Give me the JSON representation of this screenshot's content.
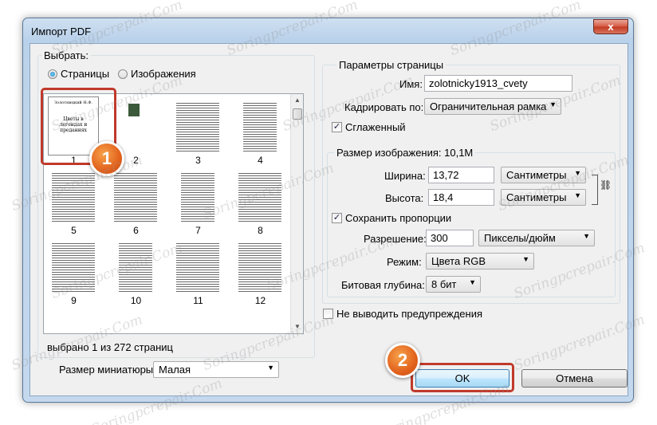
{
  "window": {
    "title": "Импорт PDF",
    "close_label": "x"
  },
  "select_group": {
    "label": "Выбрать:",
    "radio_pages": "Страницы",
    "radio_images": "Изображения",
    "selected": "Страницы"
  },
  "thumbnails": [
    {
      "num": "1",
      "selected": true,
      "cover_text": "Цветы в легендах и преданиях",
      "header": "Золотницкий Н.Ф."
    },
    {
      "num": "2"
    },
    {
      "num": "3"
    },
    {
      "num": "4"
    },
    {
      "num": "5"
    },
    {
      "num": "6"
    },
    {
      "num": "7"
    },
    {
      "num": "8"
    },
    {
      "num": "9"
    },
    {
      "num": "10"
    },
    {
      "num": "11"
    },
    {
      "num": "12"
    }
  ],
  "selection_status": "выбрано 1 из 272 страниц",
  "thumb_size": {
    "label": "Размер миниатюры:",
    "value": "Малая"
  },
  "page_params": {
    "label": "Параметры страницы",
    "name_label": "Имя:",
    "name_value": "zolotnicky1913_cvety",
    "crop_label": "Кадрировать по:",
    "crop_value": "Ограничительная рамка",
    "smoothed_label": "Сглаженный",
    "smoothed_checked": true
  },
  "image_size": {
    "label": "Размер изображения: 10,1M",
    "width_label": "Ширина:",
    "width_value": "13,72",
    "width_unit": "Сантиметры",
    "height_label": "Высота:",
    "height_value": "18,4",
    "height_unit": "Сантиметры",
    "constrain_label": "Сохранить пропорции",
    "constrain_checked": true,
    "resolution_label": "Разрешение:",
    "resolution_value": "300",
    "resolution_unit": "Пикселы/дюйм",
    "mode_label": "Режим:",
    "mode_value": "Цвета RGB",
    "bitdepth_label": "Битовая глубина:",
    "bitdepth_value": "8 бит"
  },
  "suppress_warnings": {
    "label": "Не выводить предупреждения",
    "checked": false
  },
  "buttons": {
    "ok": "OK",
    "cancel": "Отмена"
  },
  "annotations": {
    "step1": "1",
    "step2": "2",
    "accent_color": "#e2621d",
    "frame_color": "#c0392b"
  },
  "watermark": "Soringpcrepair.Com"
}
